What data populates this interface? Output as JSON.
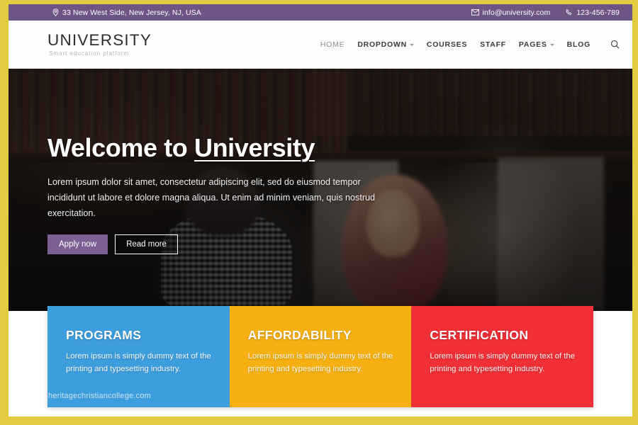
{
  "theme": {
    "frame_gold": "#e3cc3f",
    "topbar_purple": "#6d5586",
    "accent_purple": "#7b5f95",
    "card_blue": "#3d9ede",
    "card_amber": "#f6b012",
    "card_red": "#f12f36"
  },
  "topbar": {
    "address": "33 New West Side, New Jersey, NJ, USA",
    "email": "info@university.com",
    "phone": "123-456-789"
  },
  "header": {
    "logo_title": "UNIVERSITY",
    "logo_subtitle": "Smart education platform",
    "nav": [
      {
        "label": "HOME",
        "caret": false,
        "active": true
      },
      {
        "label": "DROPDOWN",
        "caret": true,
        "active": false
      },
      {
        "label": "COURSES",
        "caret": false,
        "active": false
      },
      {
        "label": "STAFF",
        "caret": false,
        "active": false
      },
      {
        "label": "PAGES",
        "caret": true,
        "active": false
      },
      {
        "label": "BLOG",
        "caret": false,
        "active": false
      }
    ],
    "search_label": "Search"
  },
  "hero": {
    "title_lead": "Welcome to ",
    "title_underlined": "University",
    "paragraph": "Lorem ipsum dolor sit amet, consectetur adipiscing elit, sed do eiusmod tempor incididunt ut labore et dolore magna aliqua. Ut enim ad minim veniam, quis nostrud exercitation.",
    "primary_button": "Apply now",
    "secondary_button": "Read more"
  },
  "cards": [
    {
      "title": "PROGRAMS",
      "description": "Lorem ipsum is simply dummy text of the printing and typesetting industry."
    },
    {
      "title": "AFFORDABILITY",
      "description": "Lorem ipsum is simply dummy text of the printing and typesetting industry."
    },
    {
      "title": "CERTIFICATION",
      "description": "Lorem ipsum is simply dummy text of the printing and typesetting industry."
    }
  ],
  "watermark": "heritagechristiancollege.com"
}
